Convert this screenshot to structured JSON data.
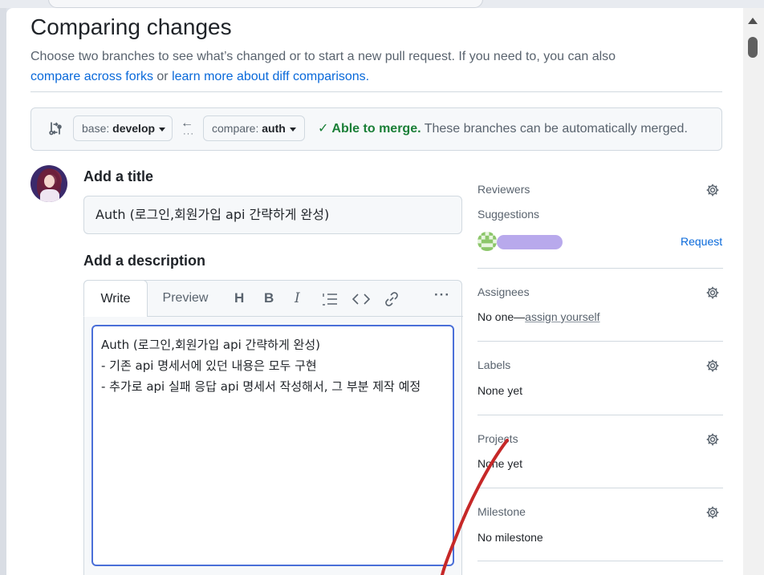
{
  "header": {
    "title": "Comparing changes",
    "subtitle_text": "Choose two branches to see what’s changed or to start a new pull request. If you need to, you can also",
    "compare_forks_link": "compare across forks",
    "or_text": " or ",
    "learn_more_link": "learn more about diff comparisons."
  },
  "compare": {
    "base_prefix": "base:",
    "base_branch": "develop",
    "compare_prefix": "compare:",
    "compare_branch": "auth",
    "merge_ok": "Able to merge.",
    "merge_rest": " These branches can be automatically merged."
  },
  "form": {
    "title_label": "Add a title",
    "title_value": "Auth (로그인,회원가입 api 간략하게 완성)",
    "description_label": "Add a description",
    "tabs": [
      "Write",
      "Preview"
    ],
    "description_text": "Auth (로그인,회원가입 api 간략하게 완성)\n- 기존 api 명세서에 있던 내용은 모두 구현\n- 추가로 api 실패 응답 api 명세서 작성해서, 그 부분 제작 예정",
    "toolbar": {
      "heading": "H",
      "bold": "B",
      "italic": "I",
      "more": "···"
    }
  },
  "sidebar": {
    "reviewers_title": "Reviewers",
    "suggestions_label": "Suggestions",
    "request_label": "Request",
    "assignees_title": "Assignees",
    "assignees_none": "No one—",
    "assign_yourself": "assign yourself",
    "labels_title": "Labels",
    "labels_value": "None yet",
    "projects_title": "Projects",
    "projects_value": "None yet",
    "milestone_title": "Milestone",
    "milestone_value": "No milestone"
  },
  "colors": {
    "accent_link": "#0969da",
    "merge_green": "#1a7f37",
    "focus_border": "#4a6fd8",
    "annotation_red": "#c62828"
  }
}
